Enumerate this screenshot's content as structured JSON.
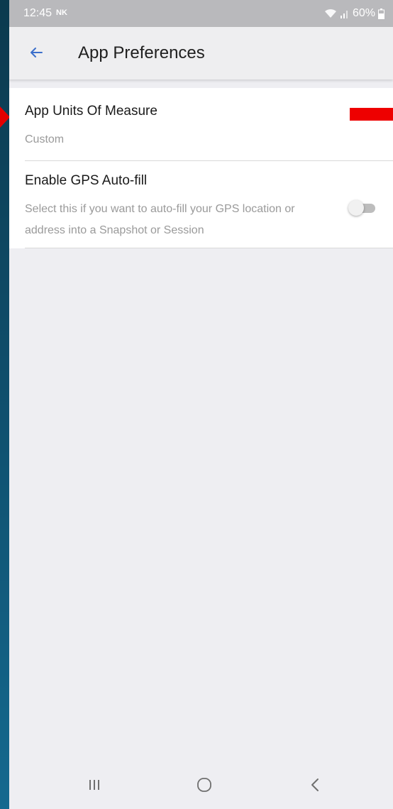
{
  "status_bar": {
    "time": "12:45",
    "carrier_badge": "NK",
    "battery": "60%",
    "icons": [
      "wifi-icon",
      "signal-icon",
      "battery-icon"
    ]
  },
  "app_bar": {
    "back_icon": "arrow-left-icon",
    "title": "App Preferences",
    "accent_color": "#3b6fcb"
  },
  "settings": {
    "units": {
      "title": "App Units Of Measure",
      "value": "Custom"
    },
    "gps": {
      "title": "Enable GPS Auto-fill",
      "description": "Select this if you want to auto-fill your GPS location or address into a Snapshot or Session",
      "enabled": false
    }
  },
  "annotations": {
    "marker_color": "#ee0000"
  },
  "nav_bar": {
    "icons": [
      "recents-icon",
      "home-icon",
      "back-icon"
    ]
  }
}
